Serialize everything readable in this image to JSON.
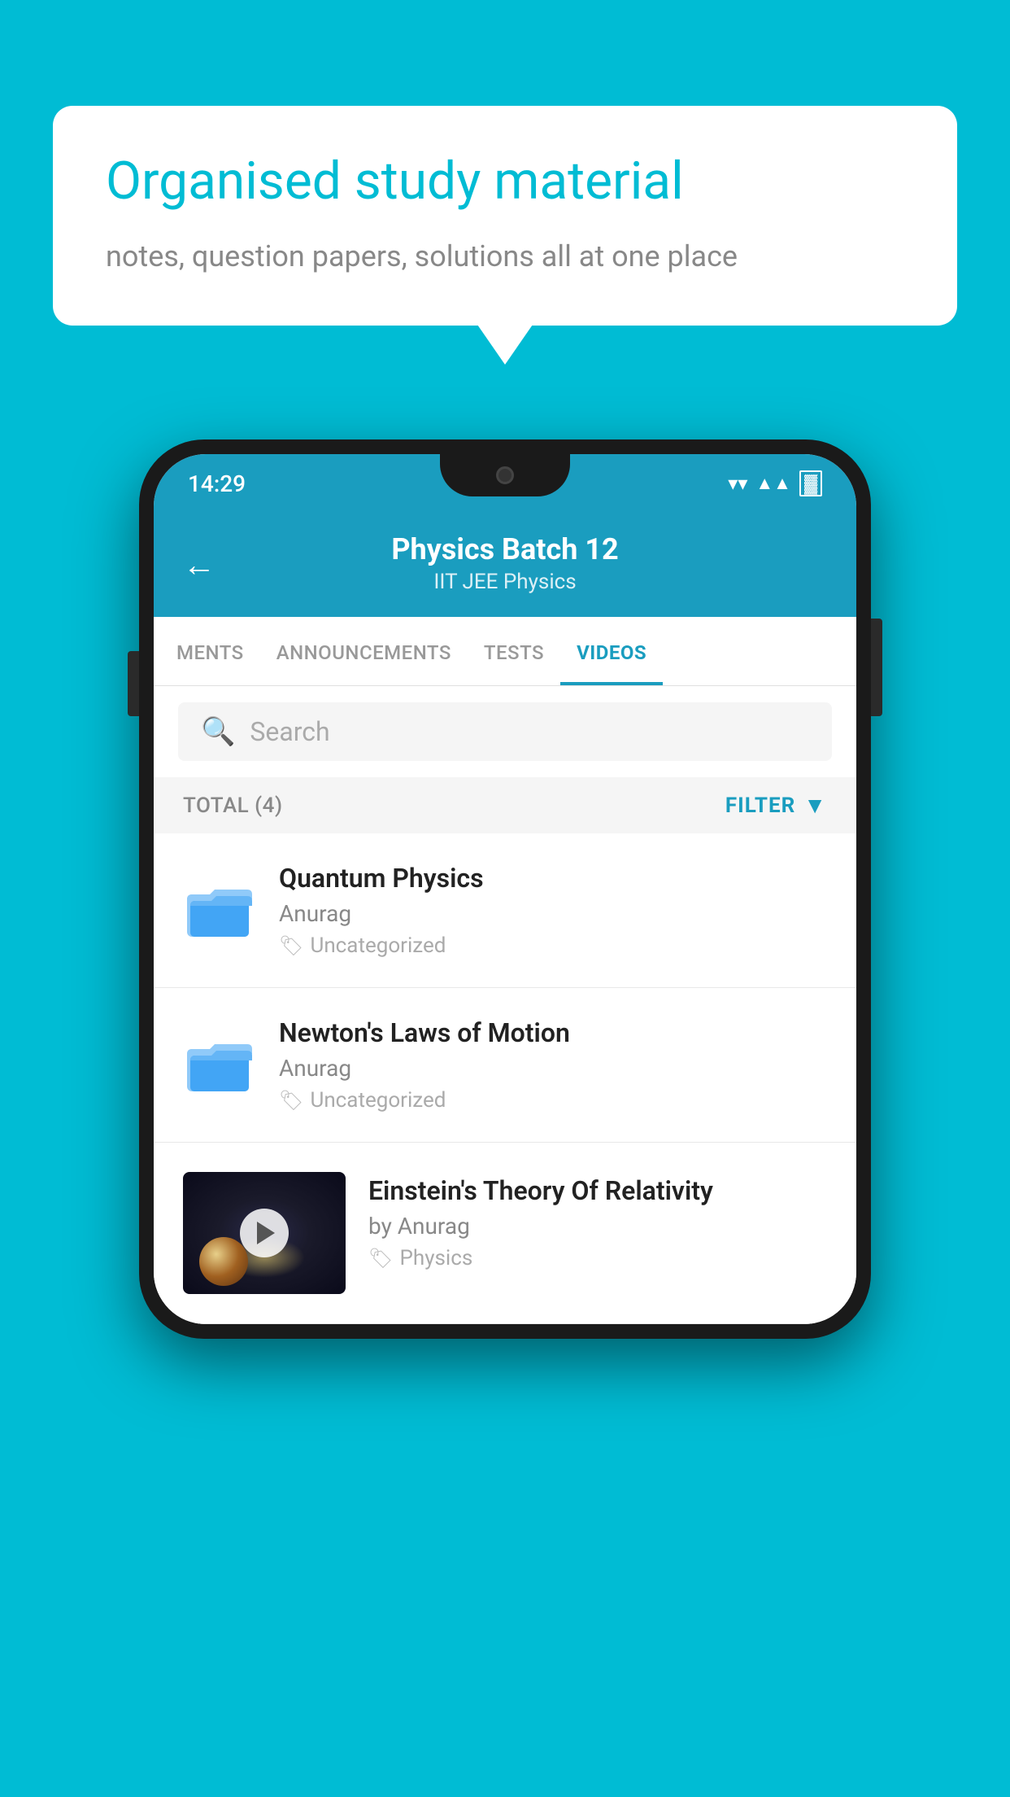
{
  "background_color": "#00bcd4",
  "speech_bubble": {
    "title": "Organised study material",
    "subtitle": "notes, question papers, solutions all at one place"
  },
  "phone": {
    "status_bar": {
      "time": "14:29",
      "icons": [
        "wifi",
        "signal",
        "battery"
      ]
    },
    "header": {
      "back_label": "←",
      "title": "Physics Batch 12",
      "subtitle": "IIT JEE   Physics"
    },
    "tabs": [
      {
        "label": "MENTS",
        "active": false
      },
      {
        "label": "ANNOUNCEMENTS",
        "active": false
      },
      {
        "label": "TESTS",
        "active": false
      },
      {
        "label": "VIDEOS",
        "active": true
      }
    ],
    "search": {
      "placeholder": "Search"
    },
    "filter": {
      "total_label": "TOTAL (4)",
      "filter_label": "FILTER"
    },
    "videos": [
      {
        "id": 1,
        "title": "Quantum Physics",
        "author": "Anurag",
        "tag": "Uncategorized",
        "has_thumbnail": false
      },
      {
        "id": 2,
        "title": "Newton's Laws of Motion",
        "author": "Anurag",
        "tag": "Uncategorized",
        "has_thumbnail": false
      },
      {
        "id": 3,
        "title": "Einstein's Theory Of Relativity",
        "author": "by Anurag",
        "tag": "Physics",
        "has_thumbnail": true
      }
    ]
  }
}
